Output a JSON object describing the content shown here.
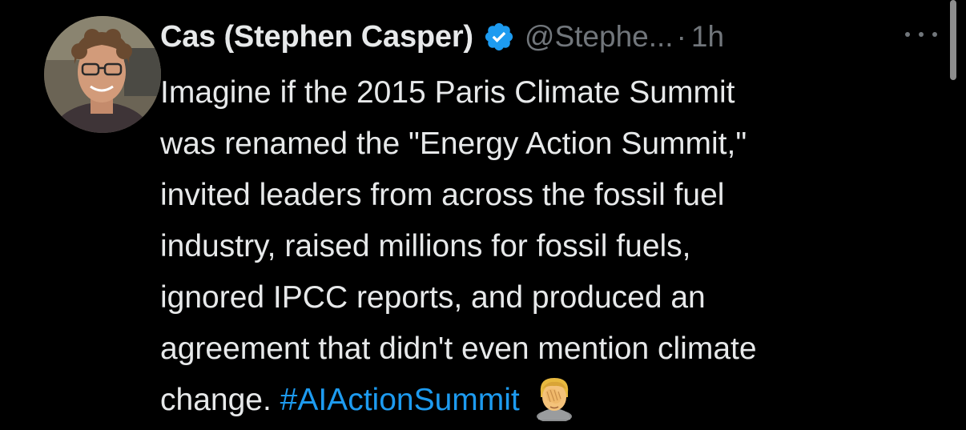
{
  "tweet": {
    "author": {
      "display_name": "Cas (Stephen Casper)",
      "handle": "@Stephe...",
      "verified": true,
      "avatar": "user-photo"
    },
    "separator": "·",
    "time": "1h",
    "more_icon": "more-horizontal-icon",
    "body_lines": [
      "Imagine if the 2015 Paris Climate Summit",
      "was renamed the \"Energy Action Summit,\"",
      "invited leaders from across the fossil fuel",
      "industry, raised millions for fossil fuels,",
      "ignored IPCC reports, and produced an",
      "agreement that didn't even mention climate",
      "change."
    ],
    "hashtag": "#AIActionSummit",
    "emoji": "face-palm-emoji"
  },
  "colors": {
    "background": "#000000",
    "text": "#e7e9ea",
    "muted": "#71767b",
    "accent": "#1d9bf0"
  }
}
